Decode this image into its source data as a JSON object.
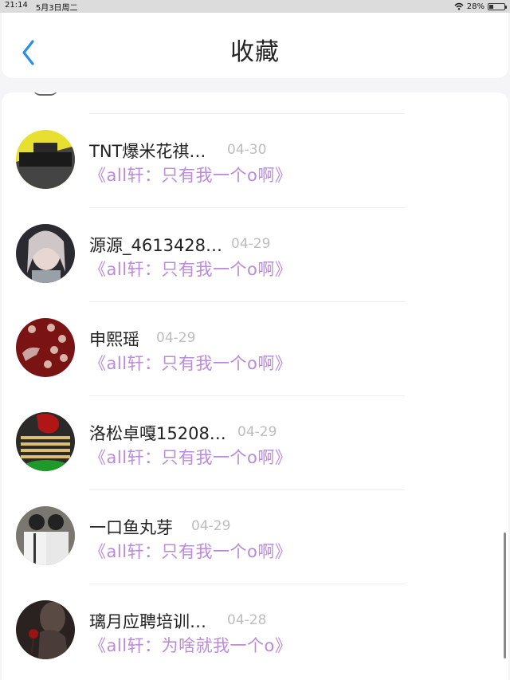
{
  "status": {
    "time": "21:14",
    "date": "5月3日周二",
    "battery": "28%",
    "battery_level": 0.28
  },
  "header": {
    "title": "收藏"
  },
  "items": [
    {
      "name": "TNT爆米花祺…",
      "date": "04-30",
      "message": "《all轩：只有我一个o啊》"
    },
    {
      "name": "源源_4613428…",
      "date": "04-29",
      "message": "《all轩：只有我一个o啊》"
    },
    {
      "name": "申熙瑶",
      "date": "04-29",
      "message": "《all轩：只有我一个o啊》"
    },
    {
      "name": "洛松卓嘎15208…",
      "date": "04-29",
      "message": "《all轩：只有我一个o啊》"
    },
    {
      "name": "一口鱼丸芽",
      "date": "04-29",
      "message": "《all轩：只有我一个o啊》"
    },
    {
      "name": "璃月应聘培训…",
      "date": "04-28",
      "message": "《all轩：为啥就我一个o》"
    }
  ]
}
